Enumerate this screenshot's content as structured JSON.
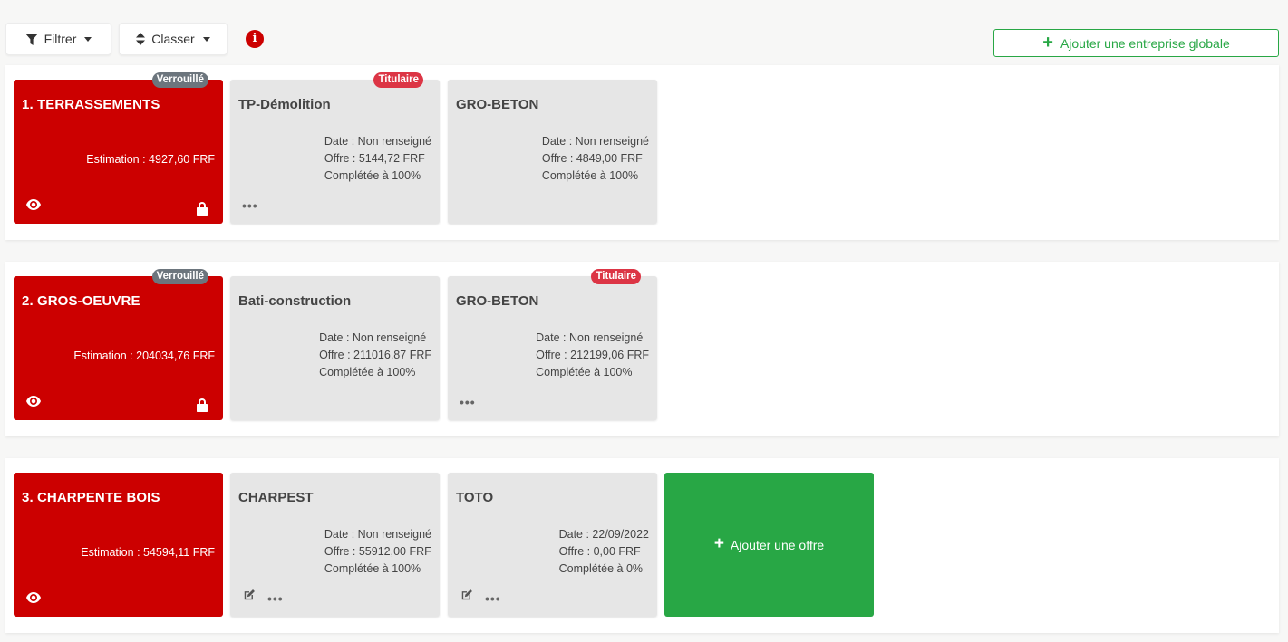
{
  "toolbar": {
    "filter_label": "Filtrer",
    "sort_label": "Classer",
    "info_glyph": "i",
    "add_global_label": "Ajouter une entreprise globale",
    "add_glyph": "+"
  },
  "colors": {
    "lot_red": "#cc0000",
    "offer_grey": "#e6e6e6",
    "accent_green": "#28a745",
    "badge_grey": "#6c757d",
    "badge_red": "#dc3545"
  },
  "icons": [
    "filter-icon",
    "sort-icon",
    "info-icon",
    "plus-icon",
    "eye-icon",
    "lock-icon",
    "edit-icon",
    "more-dots-icon"
  ],
  "lots": [
    {
      "title": "1. TERRASSEMENTS",
      "estimation": "Estimation : 4927,60 FRF",
      "badge": "Verrouillé",
      "offers": [
        {
          "name": "TP-Démolition",
          "badge": "Titulaire",
          "date": "Date : Non renseigné",
          "offre": "Offre : 5144,72 FRF",
          "completion": "Complétée à 100%",
          "dots": "•••"
        },
        {
          "name": "GRO-BETON",
          "date": "Date : Non renseigné",
          "offre": "Offre : 4849,00 FRF",
          "completion": "Complétée à 100%"
        }
      ]
    },
    {
      "title": "2. GROS-OEUVRE",
      "estimation": "Estimation : 204034,76 FRF",
      "badge": "Verrouillé",
      "offers": [
        {
          "name": "Bati-construction",
          "date": "Date : Non renseigné",
          "offre": "Offre : 211016,87 FRF",
          "completion": "Complétée à 100%"
        },
        {
          "name": "GRO-BETON",
          "badge": "Titulaire",
          "date": "Date : Non renseigné",
          "offre": "Offre : 212199,06 FRF",
          "completion": "Complétée à 100%",
          "dots": "•••"
        }
      ]
    },
    {
      "title": "3. CHARPENTE BOIS",
      "estimation": "Estimation : 54594,11 FRF",
      "offers": [
        {
          "name": "CHARPEST",
          "date": "Date : Non renseigné",
          "offre": "Offre : 55912,00 FRF",
          "completion": "Complétée à 100%",
          "dots": "•••"
        },
        {
          "name": "TOTO",
          "date": "Date : 22/09/2022",
          "offre": "Offre : 0,00 FRF",
          "completion": "Complétée à 0%",
          "dots": "•••"
        }
      ],
      "add_offer_label": "Ajouter une offre"
    }
  ]
}
